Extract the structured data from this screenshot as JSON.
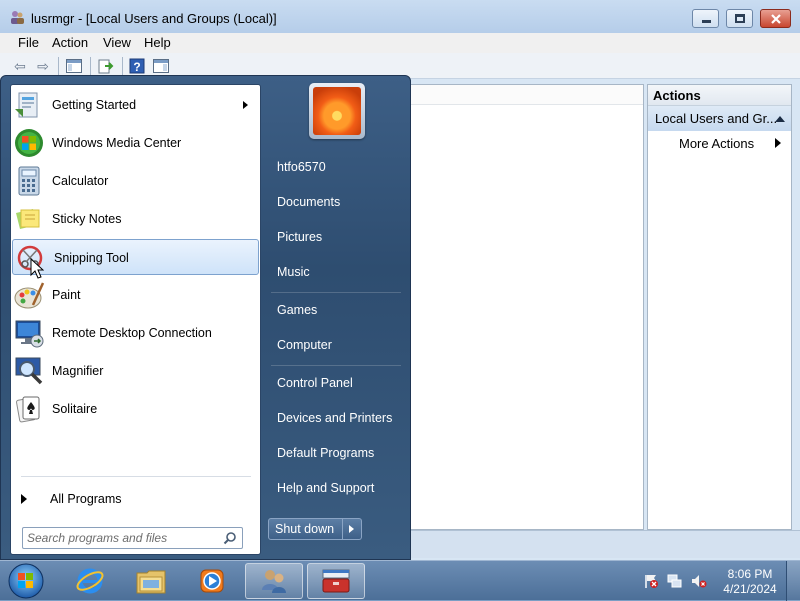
{
  "window": {
    "title": "lusrmgr - [Local Users and Groups (Local)]",
    "menu": [
      "File",
      "Action",
      "View",
      "Help"
    ],
    "actions_pane": {
      "header": "Actions",
      "section": "Local Users and Gr...",
      "more_actions": "More Actions"
    }
  },
  "start_menu": {
    "programs": [
      {
        "label": "Getting Started",
        "icon": "getting-started-icon",
        "has_submenu": true
      },
      {
        "label": "Windows Media Center",
        "icon": "media-center-icon"
      },
      {
        "label": "Calculator",
        "icon": "calculator-icon"
      },
      {
        "label": "Sticky Notes",
        "icon": "sticky-notes-icon"
      },
      {
        "label": "Snipping Tool",
        "icon": "snipping-tool-icon",
        "highlighted": true
      },
      {
        "label": "Paint",
        "icon": "paint-icon"
      },
      {
        "label": "Remote Desktop Connection",
        "icon": "remote-desktop-icon"
      },
      {
        "label": "Magnifier",
        "icon": "magnifier-icon"
      },
      {
        "label": "Solitaire",
        "icon": "solitaire-icon"
      }
    ],
    "all_programs": "All Programs",
    "search_placeholder": "Search programs and files",
    "user_name": "htfo6570",
    "right_items": [
      "Documents",
      "Pictures",
      "Music",
      "Games",
      "Computer",
      "Control Panel",
      "Devices and Printers",
      "Default Programs",
      "Help and Support"
    ],
    "shutdown": "Shut down"
  },
  "taskbar": {
    "time": "8:06 PM",
    "date": "4/21/2024",
    "pinned": [
      "internet-explorer-icon",
      "explorer-folder-icon",
      "media-player-icon",
      "users-mmc-icon",
      "toolbox-icon"
    ]
  }
}
